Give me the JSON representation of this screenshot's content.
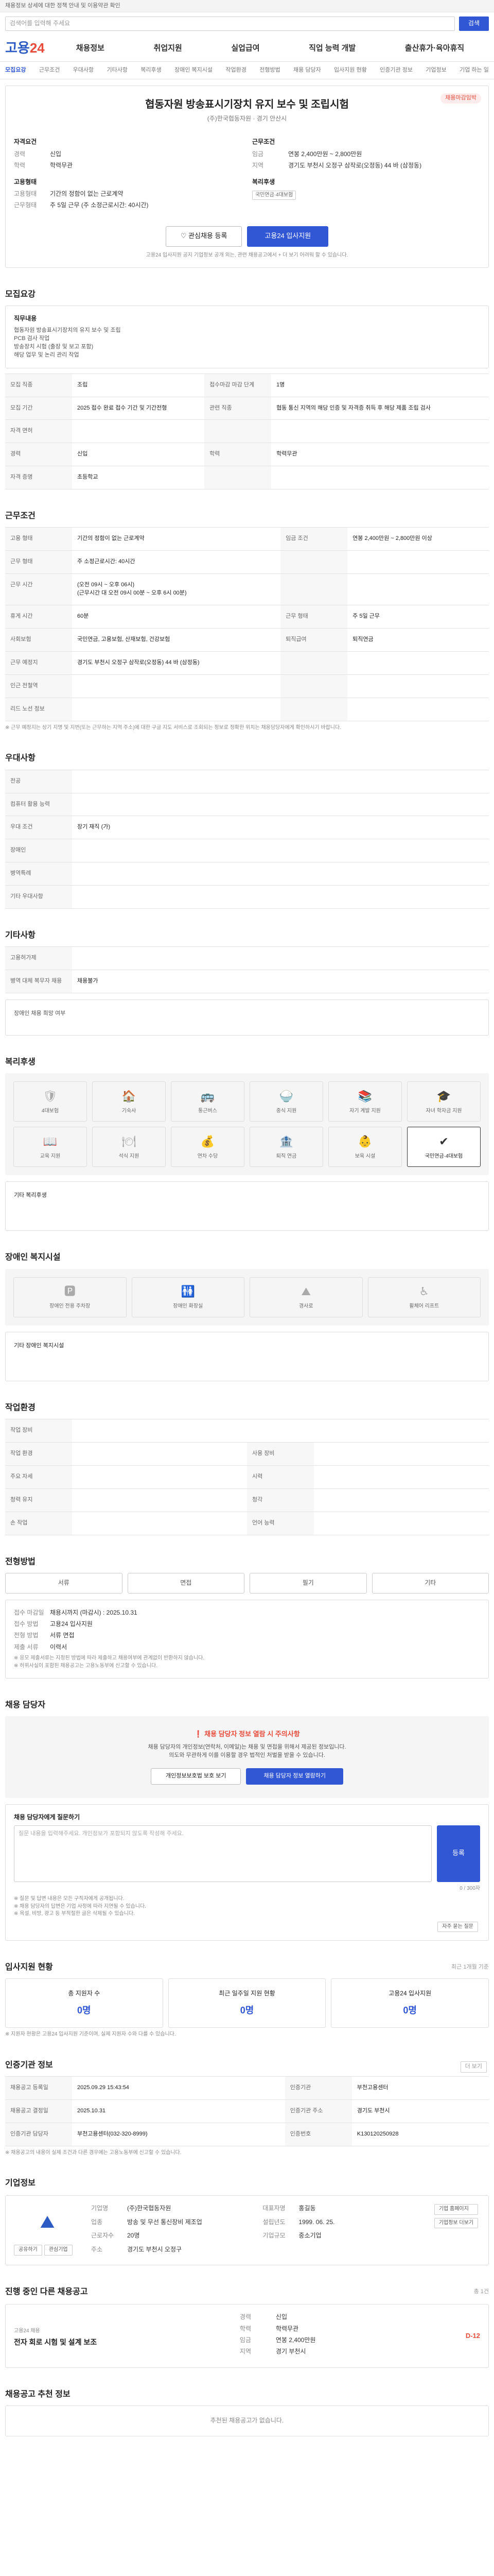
{
  "topbar": {
    "notice": "채용정보 상세에 대한 정책 안내 및 이용약관 확인"
  },
  "search": {
    "placeholder": "검색어를 입력해 주세요",
    "button": "검색"
  },
  "gnb": {
    "logo_a": "고용",
    "logo_b": "24",
    "menu": [
      "채용정보",
      "취업지원",
      "실업급여",
      "직업 능력 개발",
      "출산휴가·육아휴직"
    ]
  },
  "tabs": [
    "모집요강",
    "근무조건",
    "우대사항",
    "기타사항",
    "복리후생",
    "장애인 복지시설",
    "작업환경",
    "전형방법",
    "채용 담당자",
    "입사지원 현황",
    "인증기관 정보",
    "기업정보",
    "기업 하는 일"
  ],
  "job": {
    "badge": "채용마감임박",
    "title": "협동자원 방송표시기장치 유지 보수 및 조립시험",
    "company": "(주)한국협동자원 · 경기 안산시",
    "left_label": "자격요건",
    "kv_left": [
      {
        "k": "경력",
        "v": "신입"
      },
      {
        "k": "학력",
        "v": "학력무관"
      }
    ],
    "right_label": "근무조건",
    "kv_right": [
      {
        "k": "임금",
        "v": "연봉 2,400만원 ~ 2,800만원"
      },
      {
        "k": "지역",
        "v": "경기도 부천시 오정구 삼작로(오정동) 44 바 (삼정동)"
      }
    ],
    "left_label2": "고용형태",
    "kv_left2": [
      {
        "k": "고용형태",
        "v": "기간의 정함이 없는 근로계약"
      },
      {
        "k": "근무형태",
        "v": "주 5일 근무 (주 소정근로시간: 40시간)"
      }
    ],
    "right_label2": "복리후생",
    "benefit_chip": "국민연금·4대보험",
    "btn_interest": "관심채용 등록",
    "btn_apply": "고용24 입사지원",
    "note": "고용24 입사지원 공지 기업정보 공개 외는, 관련 채용공고에서 + 더 보기 어려워 할 수 있습니다."
  },
  "recruit": {
    "title": "모집요강",
    "intro_label": "직무내용",
    "intro": "협동자원 방송표시기장치의 유지 보수 및 조립\nPCB 검사 작업\n방송장치 시험 (출장 및 보고 포함)\n해당 업무 및 논리 관리 작업",
    "rows": [
      [
        "모집 직종",
        "조립",
        "접수마감 마감 단계",
        "1명"
      ],
      [
        "모집 기간",
        "2025 접수 완료 접수 기간 및 기간전형",
        "관련 직종",
        "협동 통신 지역의 해당 인증 및 자격증 취득 후 해당 제품 조립 검사"
      ],
      [
        "자격 면허",
        "",
        "",
        ""
      ],
      [
        "경력",
        "신입",
        "학력",
        "학력무관"
      ],
      [
        "자격 증명",
        "초등학교",
        "",
        ""
      ]
    ]
  },
  "work": {
    "title": "근무조건",
    "rows": [
      [
        "고용 형태",
        "기간의 정함이 없는 근로계약",
        "임금 조건",
        "연봉 2,400만원 ~ 2,800만원 이상"
      ],
      [
        "근무 형태",
        "주 소정근로시간: 40시간",
        "",
        ""
      ],
      [
        "근무 시간",
        "(오전 09시 ~ 오후 06시)\n(근무시간 대 오전 09시 00분 ~ 오후 6시 00분)",
        "",
        ""
      ],
      [
        "휴게 시간",
        "60분",
        "근무 형태",
        "주 5일 근무"
      ],
      [
        "사회보험",
        "국민연금, 고용보험, 산재보험, 건강보험",
        "퇴직급여",
        "퇴직연금"
      ],
      [
        "근무 예정지",
        "경기도 부천시 오정구 삼작로(오정동) 44 바 (삼정동)",
        "",
        ""
      ],
      [
        "인근 전철역",
        "",
        "",
        ""
      ],
      [
        "리드 노선 정보",
        "",
        "",
        ""
      ]
    ],
    "map_btn": "지도 보기",
    "note": "※ 근무 예정지는 상기 지명 및 지번(또는 근무하는 지역 주소)에 대한 구글 지도 서비스로 조회되는 정보로 정확한 위치는 채용담당자에게 확인하시기 바랍니다."
  },
  "prefer": {
    "title": "우대사항",
    "rows": [
      [
        "전공",
        ""
      ],
      [
        "컴퓨터 활용 능력",
        ""
      ],
      [
        "우대 조건",
        "장기 재직 (가)"
      ],
      [
        "장애인",
        ""
      ],
      [
        "병역특례",
        ""
      ],
      [
        "기타 우대사항",
        ""
      ]
    ]
  },
  "etc": {
    "title": "기타사항",
    "rows": [
      [
        "고용허가제",
        ""
      ],
      [
        "병역 대체 복무자 채용",
        "채용불가"
      ]
    ],
    "extra": "장애인 채용 희망 여부"
  },
  "welfare": {
    "title": "복리후생",
    "items": [
      "4대보험",
      "기숙사",
      "통근버스",
      "중식 지원",
      "자기 계발 지원",
      "자녀 학자금 지원",
      "교육 지원",
      "석식 지원",
      "연차 수당",
      "퇴직 연금",
      "보육 시설",
      "국민연금·4대보험"
    ],
    "on_index": 11,
    "etc_label": "기타 복리후생"
  },
  "disability": {
    "title": "장애인 복지시설",
    "items": [
      "장애인 전용 주차장",
      "장애인 화장실",
      "경사로",
      "휠체어 리프트"
    ],
    "etc_label": "기타 장애인 복지시설"
  },
  "env": {
    "title": "작업환경",
    "rows": [
      [
        "작업 장비",
        ""
      ],
      [
        "작업 환경",
        "",
        "사용 장비",
        ""
      ],
      [
        "주요 자세",
        "",
        "시력",
        ""
      ],
      [
        "청력 유지",
        "",
        "청각",
        ""
      ],
      [
        "손 작업",
        "",
        "언어 능력",
        ""
      ]
    ]
  },
  "process": {
    "title": "전형방법",
    "steps": [
      "서류",
      "면접",
      "필기",
      "기타"
    ],
    "kv": [
      [
        "접수 마감일",
        "채용시까지 (마감시) : 2025.10.31"
      ],
      [
        "접수 방법",
        "고용24 입사지원"
      ],
      [
        "전형 방법",
        "서류 면접"
      ],
      [
        "제출 서류",
        "이력서"
      ]
    ],
    "note": "※ 응모 제출서류는 지정된 방법에 따라 제출하고 채용여부에 관계없이 반환하지 않습니다.\n※ 허위사실이 포함된 채용공고는 고용노동부에 신고할 수 있습니다."
  },
  "contact": {
    "title": "채용 담당자",
    "warn": "채용 담당자 정보 열람 시 주의사항",
    "desc": "채용 담당자의 개인정보(연락처, 이메일)는 채용 및 면접을 위해서 제공된 정보입니다.\n의도와 무관하게 이를 이용할 경우 법적인 처벌을 받을 수 있습니다.",
    "btn_check": "개인정보보호법 보호 보기",
    "btn_view": "채용 담당자 정보 열람하기",
    "q_label": "채용 담당자에게 질문하기",
    "q_placeholder": "질문 내용을 입력해주세요. 개인정보가 포함되지 않도록 작성해 주세요.",
    "q_btn": "등록",
    "q_count": "0 / 300자",
    "notes": "※ 질문 및 답변 내용은 모든 구직자에게 공개됩니다.\n※ 채용 담당자의 답변은 기업 사정에 따라 지연될 수 있습니다.\n※ 욕설, 비방, 광고 등 부적절한 글은 삭제될 수 있습니다.",
    "faq_btn": "자주 묻는 질문"
  },
  "applicants": {
    "title": "입사지원 현황",
    "sub": "최근 1개월 기준",
    "items": [
      {
        "l": "총 지원자 수",
        "n": "0명"
      },
      {
        "l": "최근 일주일 지원 현황",
        "n": "0명"
      },
      {
        "l": "고용24 입사지원",
        "n": "0명"
      }
    ],
    "note": "※ 지원자 현황은 고용24 입사지원 기준이며, 실제 지원자 수와 다를 수 있습니다."
  },
  "agency": {
    "title": "인증기관 정보",
    "btn": "더 보기",
    "rows": [
      [
        "채용공고 등록일",
        "2025.09.29 15:43:54",
        "인증기관",
        "부천고용센터"
      ],
      [
        "채용공고 결정일",
        "2025.10.31",
        "인증기관 주소",
        "경기도 부천시"
      ],
      [
        "인증기관 담당자",
        "부천고용센터(032-320-8999)",
        "인증번호",
        "K130120250928"
      ]
    ],
    "note": "※ 채용공고의 내용이 실제 조건과 다른 경우에는 고용노동부에 신고할 수 있습니다."
  },
  "company": {
    "title": "기업정보",
    "logo": "⛰",
    "kv": [
      [
        "기업명",
        "(주)한국협동자원"
      ],
      [
        "대표자명",
        "홍길동"
      ],
      [
        "업종",
        "방송 및 무선 통신장비 제조업"
      ],
      [
        "설립년도",
        "1999. 06. 25."
      ],
      [
        "근로자수",
        "20명"
      ],
      [
        "기업규모",
        "중소기업"
      ],
      [
        "주소",
        "경기도 부천시 오정구"
      ]
    ],
    "btns": [
      "기업 홈페이지",
      "기업정보 더보기"
    ],
    "tags": [
      "공유하기",
      "관심기업"
    ]
  },
  "others": {
    "title": "진행 중인 다른 채용공고",
    "sub": "총 1건",
    "item": {
      "label": "고용24 채용",
      "title": "전자 회로 시험 및 설계 보조",
      "kv": [
        [
          "경력",
          "신입"
        ],
        [
          "학력",
          "학력무관"
        ],
        [
          "임금",
          "연봉 2,400만원"
        ],
        [
          "지역",
          "경기 부천시"
        ]
      ],
      "dday": "D-12"
    }
  },
  "recommend": {
    "title": "채용공고 추천 정보",
    "empty": "추천된 채용공고가 없습니다."
  }
}
